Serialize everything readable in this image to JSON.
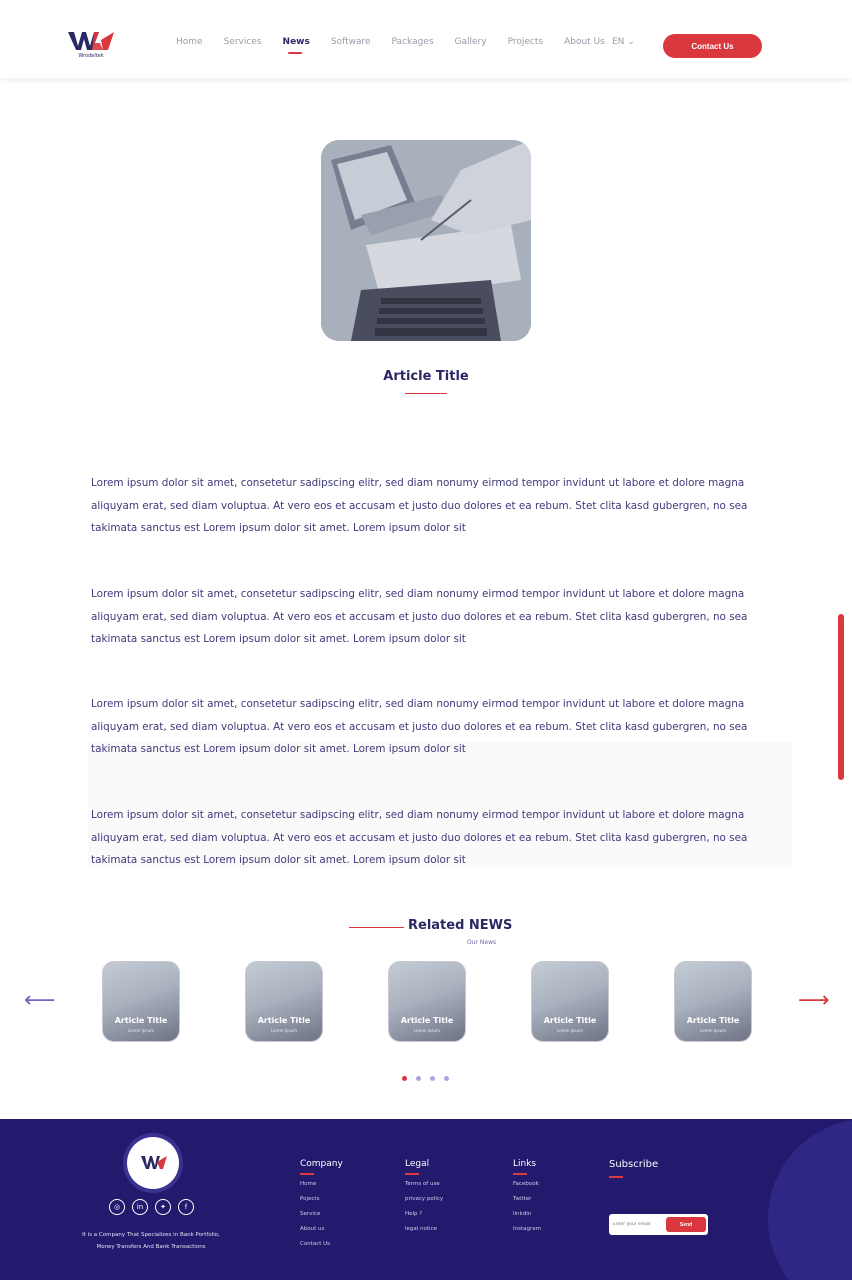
{
  "header": {
    "logo_text": "Wrodeltek",
    "nav": [
      "Home",
      "Services",
      "News",
      "Software",
      "Packages",
      "Gallery",
      "Projects",
      "About Us"
    ],
    "active_nav": "News",
    "lang": "EN ⌄",
    "contact_label": "Contact Us"
  },
  "article": {
    "title": "Article Title",
    "paragraphs": [
      "Lorem ipsum dolor sit amet, consetetur sadipscing elitr, sed diam nonumy eirmod tempor invidunt ut labore et dolore magna aliquyam erat, sed diam voluptua. At vero eos et accusam et justo duo dolores et ea rebum. Stet clita kasd gubergren, no sea takimata sanctus est Lorem ipsum dolor sit amet. Lorem ipsum dolor sit",
      "Lorem ipsum dolor sit amet, consetetur sadipscing elitr, sed diam nonumy eirmod tempor invidunt ut labore et dolore magna aliquyam erat, sed diam voluptua. At vero eos et accusam et justo duo dolores et ea rebum. Stet clita kasd gubergren, no sea takimata sanctus est Lorem ipsum dolor sit amet. Lorem ipsum dolor sit",
      "Lorem ipsum dolor sit amet, consetetur sadipscing elitr, sed diam nonumy eirmod tempor invidunt ut labore et dolore magna aliquyam erat, sed diam voluptua. At vero eos et accusam et justo duo dolores et ea rebum. Stet clita kasd gubergren, no sea takimata sanctus est Lorem ipsum dolor sit amet. Lorem ipsum dolor sit",
      "Lorem ipsum dolor sit amet, consetetur sadipscing elitr, sed diam nonumy eirmod tempor invidunt ut labore et dolore magna aliquyam erat, sed diam voluptua. At vero eos et accusam et justo duo dolores et ea rebum. Stet clita kasd gubergren, no sea takimata sanctus est Lorem ipsum dolor sit amet. Lorem ipsum dolor sit"
    ]
  },
  "related": {
    "title": "Related NEWS",
    "subtitle": "Our News",
    "cards": [
      {
        "title": "Article Title",
        "sub": "Lorem Ipsum"
      },
      {
        "title": "Article Title",
        "sub": "Lorem Ipsum"
      },
      {
        "title": "Article Title",
        "sub": "Lorem Ipsum"
      },
      {
        "title": "Article Title",
        "sub": "Lorem Ipsum"
      },
      {
        "title": "Article Title",
        "sub": "Lorem Ipsum"
      }
    ],
    "prev_icon": "arrow-left-icon",
    "next_icon": "arrow-right-icon",
    "pages": 4,
    "active_page": 1
  },
  "footer": {
    "description": "It is a Company That Specializes in Bank Portfolio, Money Transfers And Bank Transactions",
    "socials": [
      "instagram-icon",
      "linkedin-icon",
      "twitter-icon",
      "facebook-icon"
    ],
    "company": {
      "title": "Company",
      "links": [
        "Home",
        "Pojects",
        "Service",
        "About us",
        "Contact Us"
      ]
    },
    "legal": {
      "title": "Legal",
      "links": [
        "Terms of use",
        "privacy policy",
        "Help ?",
        "legal notice"
      ]
    },
    "links": {
      "title": "Links",
      "links": [
        "Facebook",
        "Twitter",
        "linkdin",
        "Instagram"
      ]
    },
    "subscribe": {
      "title": "Subscribe",
      "placeholder": "Enter your email",
      "button": "Send"
    }
  },
  "colors": {
    "accent": "#d9383e",
    "brand": "#231a6e",
    "text": "#2b2866"
  }
}
